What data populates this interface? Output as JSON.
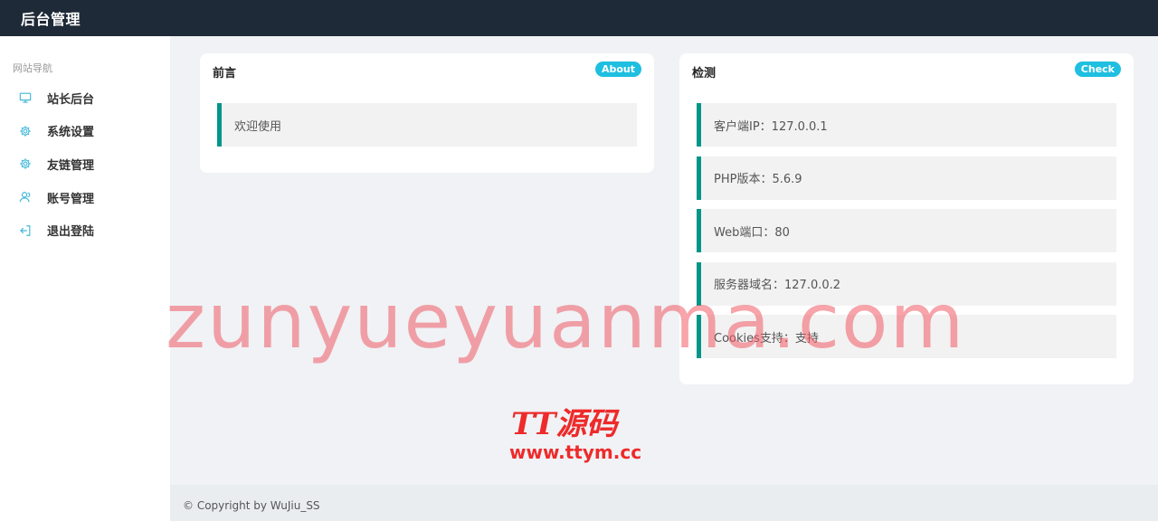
{
  "header": {
    "title": "后台管理"
  },
  "sidebar": {
    "section_title": "网站导航",
    "items": [
      {
        "label": "站长后台",
        "icon": "monitor-icon"
      },
      {
        "label": "系统设置",
        "icon": "gear-icon"
      },
      {
        "label": "友链管理",
        "icon": "gear-icon"
      },
      {
        "label": "账号管理",
        "icon": "users-icon"
      },
      {
        "label": "退出登陆",
        "icon": "logout-icon"
      }
    ]
  },
  "cards": {
    "preface": {
      "title": "前言",
      "badge": "About",
      "items": [
        "欢迎使用"
      ]
    },
    "check": {
      "title": "检测",
      "badge": "Check",
      "items": [
        "客户端IP：127.0.0.1",
        "PHP版本：5.6.9",
        "Web端口：80",
        "服务器域名：127.0.0.2",
        "Cookies支持：支持"
      ]
    }
  },
  "footer": {
    "copyright": "© Copyright by WuJiu_SS"
  },
  "watermarks": {
    "main": "zunyueyuanma.com",
    "logo": "TT源码",
    "url": "www.ttym.cc"
  },
  "colors": {
    "topbar": "#1f2a38",
    "accent": "#009688",
    "badge": "#1ebfe0",
    "icon": "#3fb7d8"
  }
}
